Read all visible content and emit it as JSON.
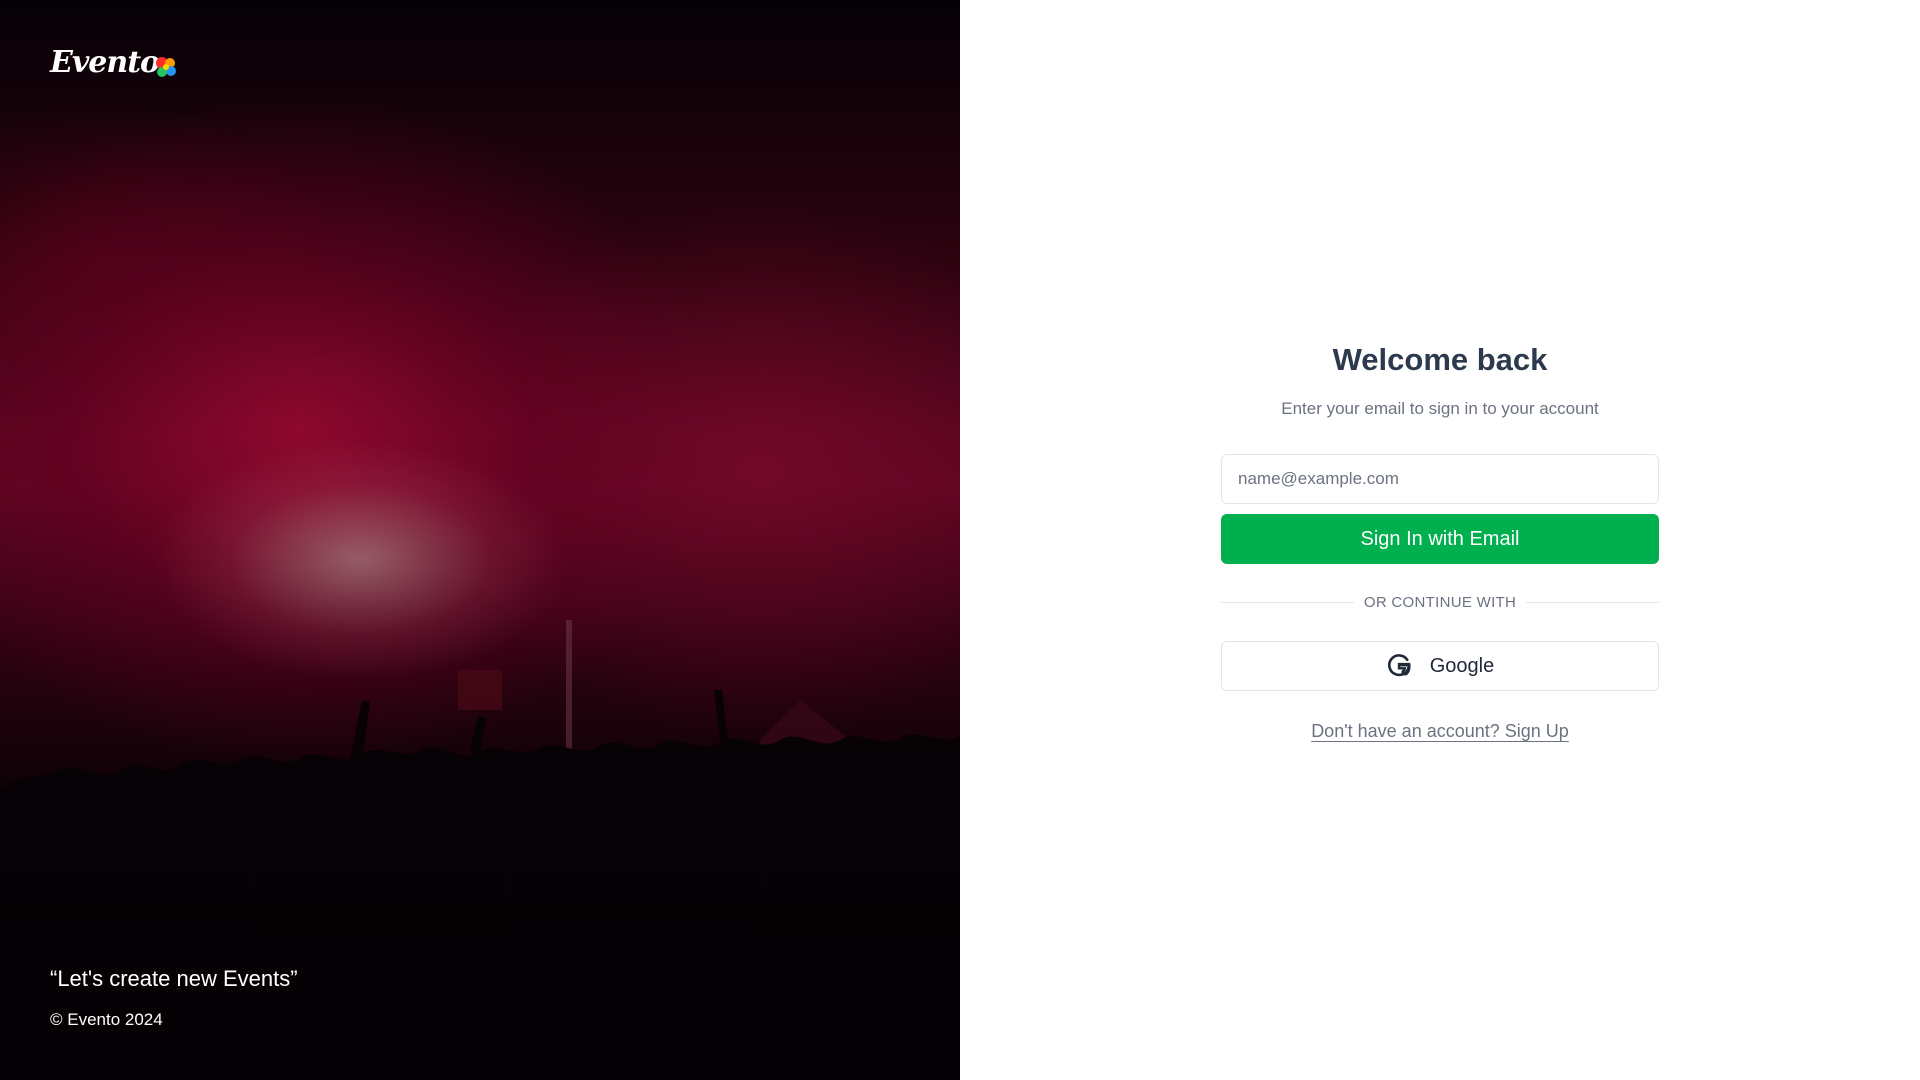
{
  "brand": {
    "logo_text": "Evento",
    "quote": "“Let's create new Events”",
    "copyright": "© Evento 2024"
  },
  "form": {
    "title": "Welcome back",
    "subtitle": "Enter your email to sign in to your account",
    "email_placeholder": "name@example.com",
    "email_value": "",
    "submit_label": "Sign In with Email",
    "divider_text": "OR CONTINUE WITH",
    "google_label": "Google",
    "signup_text": "Don't have an account? Sign Up"
  },
  "colors": {
    "primary": "#00b04f",
    "title": "#2d3a4e",
    "muted": "#6b7280",
    "border": "#e2e6ea"
  },
  "icons": {
    "logo": "evento-logo-splash-icon",
    "google": "google-icon"
  }
}
